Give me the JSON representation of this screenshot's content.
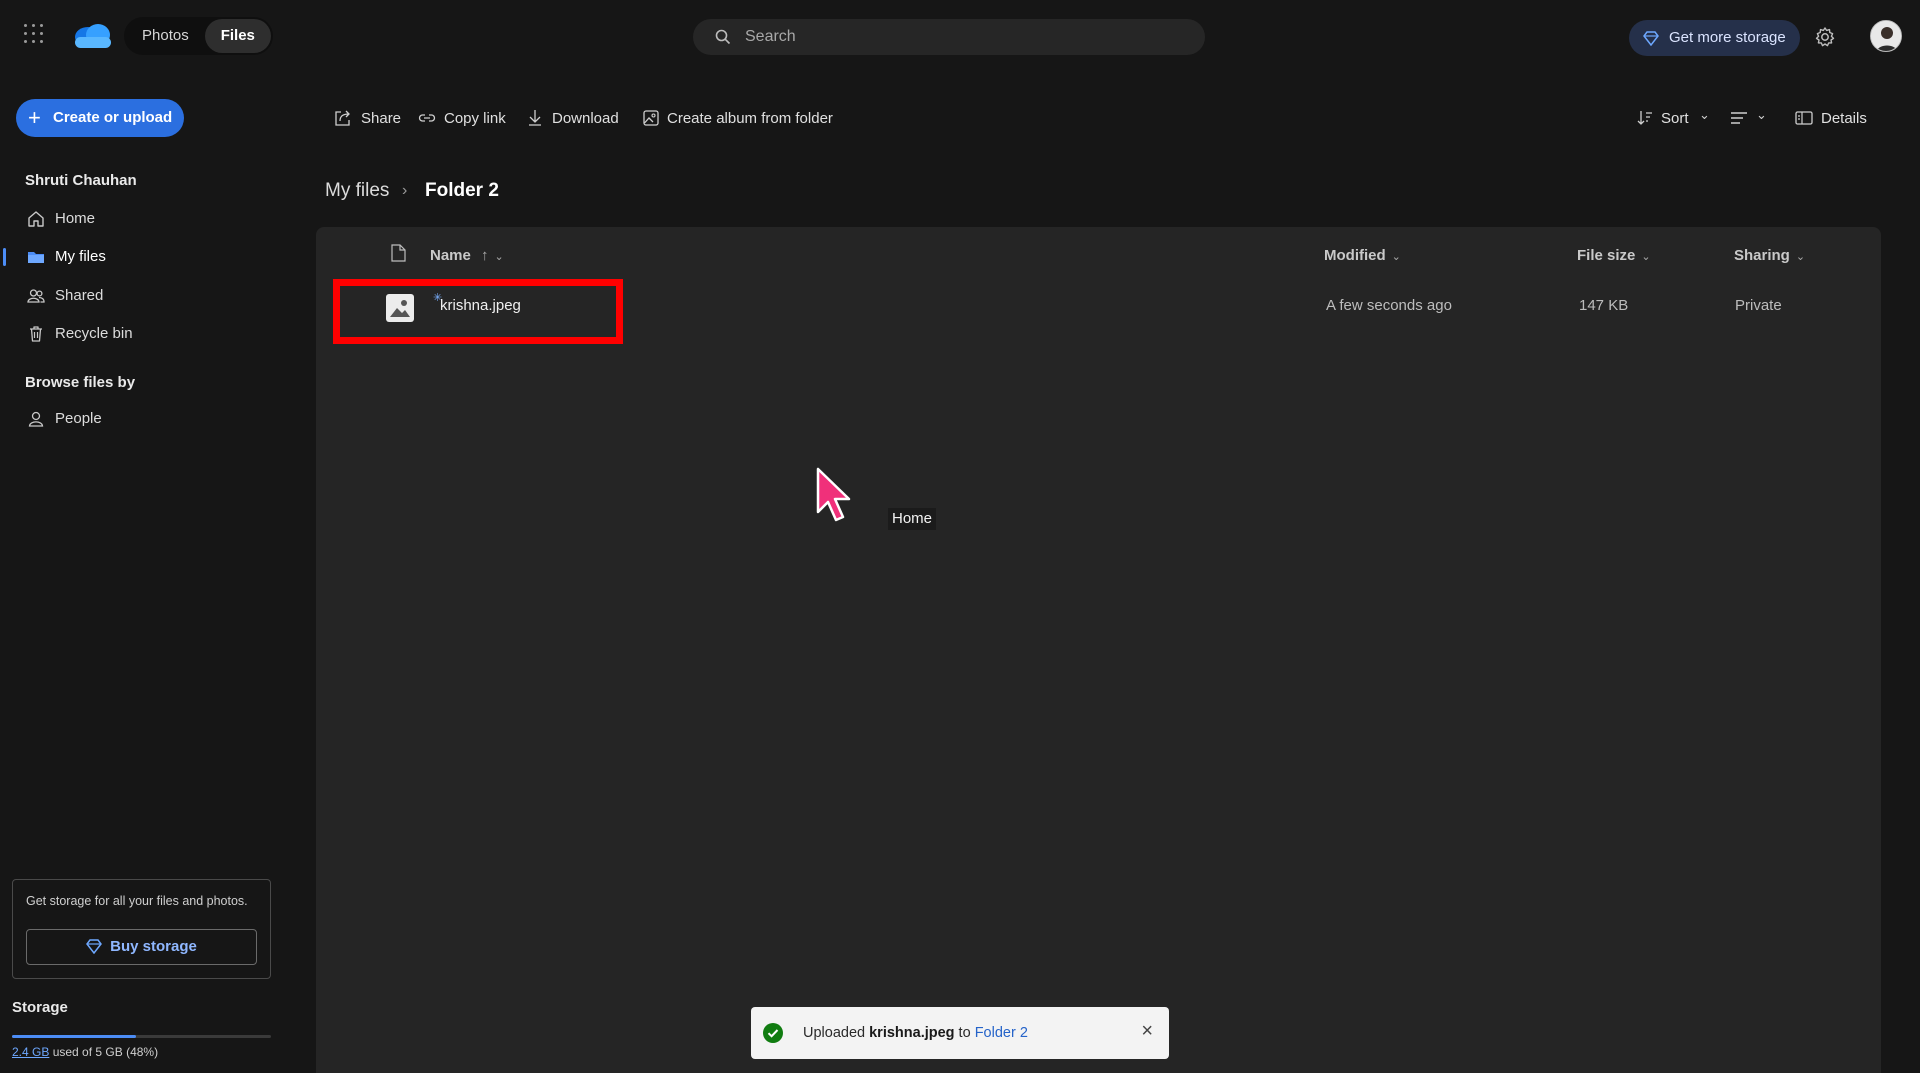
{
  "topbar": {
    "nav_tabs": [
      {
        "label": "Photos",
        "active": false
      },
      {
        "label": "Files",
        "active": true
      }
    ],
    "search_placeholder": "Search",
    "get_more_storage_label": "Get more storage",
    "icons": [
      "app-launcher-icon",
      "onedrive-logo",
      "search-icon",
      "diamond-icon",
      "gear-icon",
      "avatar"
    ]
  },
  "sidebar": {
    "create_label": "Create or upload",
    "user_name": "Shruti Chauhan",
    "nav": [
      {
        "label": "Home",
        "icon": "home-icon",
        "active": false
      },
      {
        "label": "My files",
        "icon": "folder-icon",
        "active": true
      },
      {
        "label": "Shared",
        "icon": "people-icon",
        "active": false
      },
      {
        "label": "Recycle bin",
        "icon": "trash-icon",
        "active": false
      }
    ],
    "browse_title": "Browse files by",
    "browse_items": [
      {
        "label": "People",
        "icon": "person-icon"
      }
    ],
    "promo_text": "Get storage for all your files and photos.",
    "buy_label": "Buy storage",
    "storage_title": "Storage",
    "storage_used": "2.4 GB",
    "storage_rest": " used of 5 GB (48%)",
    "storage_fraction": 0.48
  },
  "commandbar": {
    "share": "Share",
    "copy_link": "Copy link",
    "download": "Download",
    "create_album": "Create album from folder",
    "sort": "Sort",
    "details": "Details"
  },
  "breadcrumb": {
    "root": "My files",
    "separator": "›",
    "current": "Folder 2"
  },
  "list": {
    "columns": {
      "name": "Name",
      "name_sort": "↑",
      "modified": "Modified",
      "file_size": "File size",
      "sharing": "Sharing"
    },
    "rows": [
      {
        "name": "krishna.jpeg",
        "modified": "A few seconds ago",
        "size": "147 KB",
        "sharing": "Private"
      }
    ]
  },
  "tooltip": "Home",
  "toast": {
    "prefix": "Uploaded ",
    "file": "krishna.jpeg",
    "middle": " to ",
    "folder": "Folder 2",
    "close": "×"
  },
  "colors": {
    "accent": "#2b6fe0",
    "highlight": "#ff0000",
    "background": "#161616",
    "panel": "#252525",
    "success": "#107c10"
  }
}
